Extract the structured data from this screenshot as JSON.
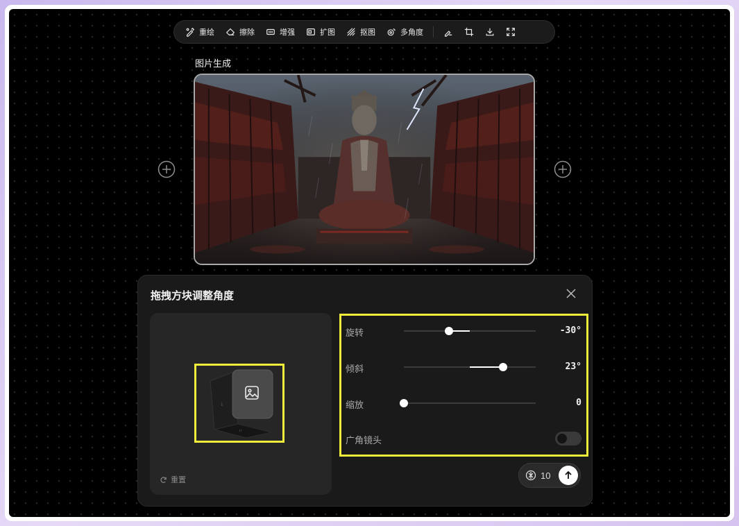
{
  "toolbar": {
    "items": [
      {
        "label": "重绘",
        "icon": "repaint-icon"
      },
      {
        "label": "擦除",
        "icon": "eraser-icon"
      },
      {
        "label": "增强",
        "icon": "hd-enhance-icon"
      },
      {
        "label": "扩图",
        "icon": "expand-image-icon"
      },
      {
        "label": "抠图",
        "icon": "cutout-icon"
      },
      {
        "label": "多角度",
        "icon": "multi-angle-icon"
      }
    ],
    "icon_buttons": [
      "brush-edit-icon",
      "crop-icon",
      "download-icon",
      "fullscreen-icon"
    ]
  },
  "canvas": {
    "node_title": "图片生成"
  },
  "panel": {
    "title": "拖拽方块调整角度",
    "reset_label": "重置",
    "controls": {
      "rotate": {
        "label": "旋转",
        "value_text": "-30°",
        "value": -30,
        "fill_from": 0.5,
        "fill_to": 0.34
      },
      "tilt": {
        "label": "倾斜",
        "value_text": "23°",
        "value": 23,
        "fill_from": 0.5,
        "fill_to": 0.75
      },
      "zoom": {
        "label": "缩放",
        "value_text": "0",
        "value": 0,
        "fill_from": 0.0,
        "fill_to": 0.0
      },
      "wide_angle": {
        "label": "广角镜头",
        "enabled": false
      }
    },
    "credits": "10"
  },
  "colors": {
    "highlight": "#f1ee3b",
    "background": "#000000",
    "panel": "#1a1a1a"
  }
}
